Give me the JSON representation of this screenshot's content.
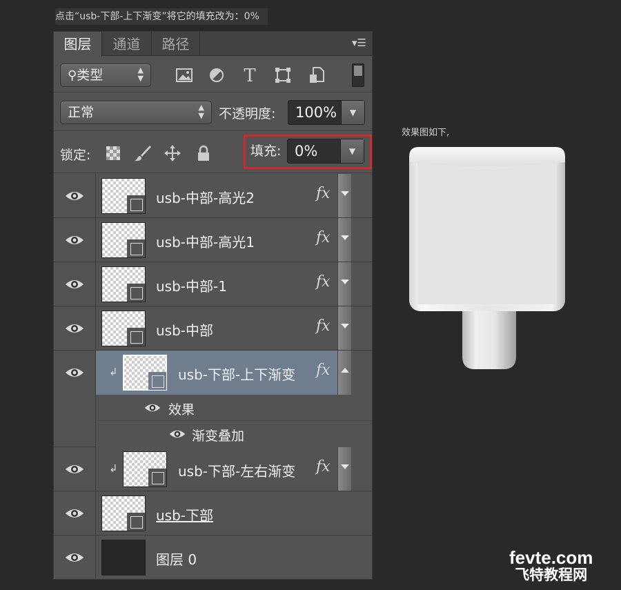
{
  "instruction": "点击“usb-下部-上下渐变”将它的填充改为：0%",
  "panel": {
    "tabs": [
      "图层",
      "通道",
      "路径"
    ],
    "filter_label": "类型",
    "blend_mode": "正常",
    "opacity_label": "不透明度:",
    "opacity_value": "100%",
    "lock_label": "锁定:",
    "fill_label": "填充:",
    "fill_value": "0%",
    "fx_symbol": "fx",
    "layers": [
      {
        "name": "usb-中部-高光2"
      },
      {
        "name": "usb-中部-高光1"
      },
      {
        "name": "usb-中部-1"
      },
      {
        "name": "usb-中部"
      },
      {
        "name": "usb-下部-上下渐变",
        "effects_label": "效果",
        "effect": "渐变叠加"
      },
      {
        "name": "usb-下部-左右渐变"
      },
      {
        "name": "usb-下部"
      },
      {
        "name": "图层 0"
      }
    ],
    "clip_arrow": "↲"
  },
  "preview": {
    "label": "效果图如下,"
  },
  "watermark": {
    "line1": "fevte.com",
    "line2": "飞特教程网"
  },
  "colors": {
    "selected_row": "#6f7d8e",
    "highlight_box": "#d22a2a"
  }
}
